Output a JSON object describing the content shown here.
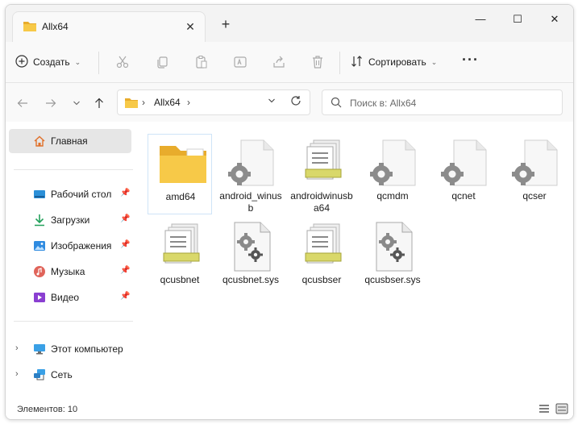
{
  "window": {
    "tab_title": "Allx64",
    "tab_close": "✕",
    "new_tab": "+",
    "minimize": "—",
    "maximize": "☐",
    "close": "✕"
  },
  "toolbar": {
    "create_label": "Создать",
    "sort_label": "Сортировать",
    "more_label": "···"
  },
  "address": {
    "path_segment": "Allx64",
    "search_placeholder": "Поиск в: Allx64"
  },
  "sidebar": {
    "home": "Главная",
    "quick_access": [
      {
        "label": "Рабочий стол",
        "icon": "desktop-icon"
      },
      {
        "label": "Загрузки",
        "icon": "downloads-icon"
      },
      {
        "label": "Изображения",
        "icon": "pictures-icon"
      },
      {
        "label": "Музыка",
        "icon": "music-icon"
      },
      {
        "label": "Видео",
        "icon": "videos-icon"
      }
    ],
    "this_pc": "Этот компьютер",
    "network": "Сеть"
  },
  "files": [
    {
      "name": "amd64",
      "type": "folder",
      "selected": true
    },
    {
      "name": "android_winusb",
      "type": "inf"
    },
    {
      "name": "androidwinusba64",
      "type": "cat"
    },
    {
      "name": "qcmdm",
      "type": "inf"
    },
    {
      "name": "qcnet",
      "type": "inf"
    },
    {
      "name": "qcser",
      "type": "inf"
    },
    {
      "name": "qcusbnet",
      "type": "cat"
    },
    {
      "name": "qcusbnet.sys",
      "type": "sys"
    },
    {
      "name": "qcusbser",
      "type": "cat"
    },
    {
      "name": "qcusbser.sys",
      "type": "sys"
    }
  ],
  "status": {
    "item_count": "Элементов: 10"
  },
  "colors": {
    "folder": "#f4c542",
    "accent": "#0067c0",
    "selected_bg": "#e6e6e6"
  }
}
